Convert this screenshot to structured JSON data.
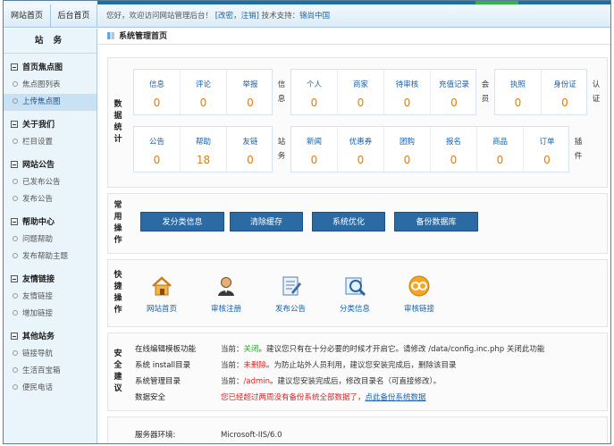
{
  "topnav": {
    "tab_home": "网站首页",
    "tab_admin": "后台首页",
    "greeting_prefix": "您好，欢迎访问网站管理后台！",
    "link_change_pwd": "[改密",
    "sep": "，",
    "link_logout": "注销]",
    "support_label": "技术支持：",
    "support_name": "锦尚中国"
  },
  "sidebar": {
    "title": "站 务",
    "groups": [
      {
        "title": "首页焦点图",
        "items": [
          "焦点图列表",
          "上传焦点图"
        ]
      },
      {
        "title": "关于我们",
        "items": [
          "栏目设置"
        ]
      },
      {
        "title": "网站公告",
        "items": [
          "已发布公告",
          "发布公告"
        ]
      },
      {
        "title": "帮助中心",
        "items": [
          "问题帮助",
          "发布帮助主题"
        ]
      },
      {
        "title": "友情链接",
        "items": [
          "友情链接",
          "增加链接"
        ]
      },
      {
        "title": "其他站务",
        "items": [
          "链接导航",
          "生活百宝箱",
          "便民电话"
        ]
      }
    ]
  },
  "main": {
    "title": "系统管理首页",
    "stats_label": "数据统计",
    "stats_row1": {
      "group_a": [
        {
          "label": "信息",
          "value": "0"
        },
        {
          "label": "评论",
          "value": "0"
        },
        {
          "label": "举报",
          "value": "0"
        }
      ],
      "mid_a": "信息",
      "group_b": [
        {
          "label": "个人",
          "value": "0"
        },
        {
          "label": "商家",
          "value": "0"
        },
        {
          "label": "待审核",
          "value": "0"
        },
        {
          "label": "充值记录",
          "value": "0"
        }
      ],
      "mid_b": "会员",
      "group_c": [
        {
          "label": "执照",
          "value": "0"
        },
        {
          "label": "身份证",
          "value": "0"
        }
      ],
      "mid_c": "认证"
    },
    "stats_row2": {
      "group_a": [
        {
          "label": "公告",
          "value": "0"
        },
        {
          "label": "帮助",
          "value": "18"
        },
        {
          "label": "友链",
          "value": "0"
        }
      ],
      "mid_a": "站务",
      "group_b": [
        {
          "label": "新闻",
          "value": "0"
        },
        {
          "label": "优惠券",
          "value": "0"
        },
        {
          "label": "团购",
          "value": "0"
        },
        {
          "label": "报名",
          "value": "0"
        },
        {
          "label": "商品",
          "value": "0"
        },
        {
          "label": "订单",
          "value": "0"
        }
      ],
      "mid_b": "插件"
    },
    "ops_label": "常用操作",
    "ops": [
      "发分类信息",
      "清除缓存",
      "系统优化",
      "备份数据库"
    ],
    "quick_label": "快捷操作",
    "quick": [
      {
        "label": "网站首页",
        "icon": "home-icon"
      },
      {
        "label": "审核注册",
        "icon": "user-icon"
      },
      {
        "label": "发布公告",
        "icon": "announce-icon"
      },
      {
        "label": "分类信息",
        "icon": "category-icon"
      },
      {
        "label": "审核链接",
        "icon": "link-icon"
      }
    ],
    "security_label": "安全建议",
    "security": [
      {
        "key": "在线编辑模板功能",
        "prefix": "当前：",
        "status": "关闭",
        "tail": "。建议您只有在十分必要的时候才开启它。请修改 /data/config.inc.php 关闭此功能"
      },
      {
        "key": "系统 install目录",
        "prefix": "当前：",
        "status": "未删除",
        "tail": "。为防止站外人员利用，建议您安装完成后，删除该目录"
      },
      {
        "key": "系统管理目录",
        "prefix": "当前：",
        "status": "/admin",
        "tail": "。建议您安装完成后，修改目录名（可直接修改）。"
      },
      {
        "key": "数据安全",
        "warn": "您已经超过两周没有备份系统全部数据了，",
        "link": "点此备份系统数据"
      }
    ],
    "server_label": "服务器环境:",
    "server_value": "Microsoft-IIS/6.0"
  },
  "colors": {
    "accent": "#2c6aa3",
    "value": "#f07800",
    "link": "#1a5fa8",
    "ok": "#2aa02a",
    "warn": "#e02020"
  }
}
